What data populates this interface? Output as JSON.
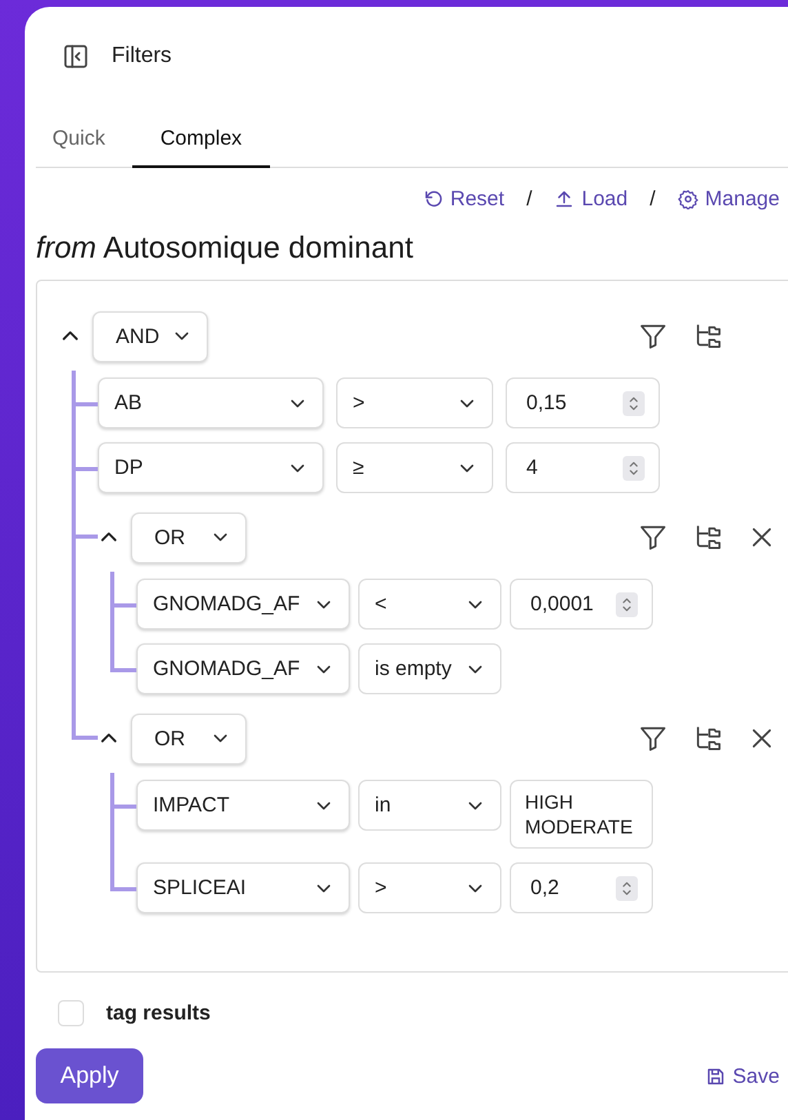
{
  "header": {
    "title": "Filters"
  },
  "tabs": [
    {
      "label": "Quick",
      "selected": false
    },
    {
      "label": "Complex",
      "selected": true
    }
  ],
  "actions": [
    {
      "kind": "reset",
      "label": "Reset"
    },
    {
      "kind": "separator",
      "label": "/"
    },
    {
      "kind": "load",
      "label": "Load"
    },
    {
      "kind": "separator",
      "label": "/"
    },
    {
      "kind": "manage",
      "label": "Manage"
    }
  ],
  "heading": "*from* Autosomique dominant",
  "query": {
    "kind": "group",
    "operator": "AND",
    "expanded": true,
    "removable": false,
    "children": [
      {
        "kind": "rule",
        "field": "AB",
        "operator": ">",
        "value": "0,15"
      },
      {
        "kind": "rule",
        "field": "DP",
        "operator": "≥",
        "value": "4"
      },
      {
        "kind": "group",
        "operator": "OR",
        "expanded": true,
        "removable": true,
        "children": [
          {
            "kind": "rule",
            "field": "GNOMADG_AF",
            "operator": "<",
            "value": "0,0001"
          },
          {
            "kind": "rule",
            "field": "GNOMADG_AF",
            "operator": "is empty"
          }
        ]
      },
      {
        "kind": "group",
        "operator": "OR",
        "expanded": true,
        "removable": true,
        "children": [
          {
            "kind": "rule",
            "field": "IMPACT",
            "operator": "in",
            "values": [
              "HIGH",
              "MODERATE"
            ]
          },
          {
            "kind": "rule",
            "field": "SPLICEAI",
            "operator": ">",
            "value": "0,2"
          }
        ]
      }
    ]
  },
  "tag_results": {
    "label": "tag results",
    "checked": false
  },
  "footer": {
    "apply": "Apply",
    "save": "Save"
  }
}
